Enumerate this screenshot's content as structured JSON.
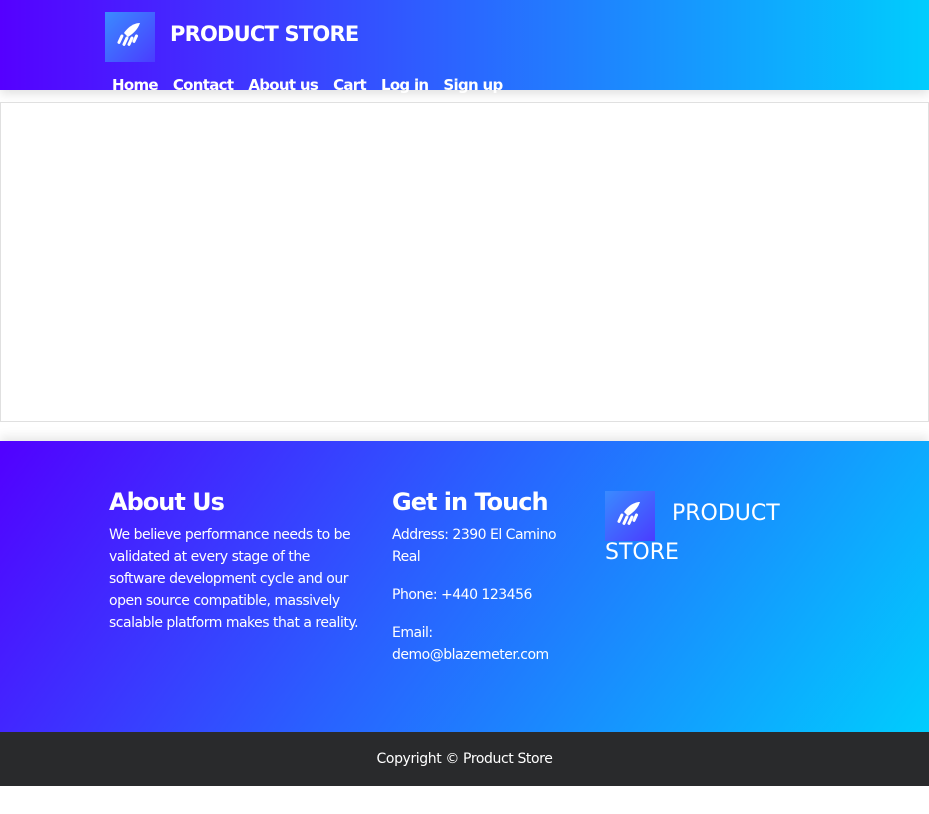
{
  "header": {
    "brand": "PRODUCT STORE",
    "logo_icon": "rocket-icon",
    "nav": [
      {
        "label": "Home"
      },
      {
        "label": "Contact"
      },
      {
        "label": "About us"
      },
      {
        "label": "Cart"
      },
      {
        "label": "Log in"
      },
      {
        "label": "Sign up"
      }
    ]
  },
  "footer": {
    "about": {
      "title": "About Us",
      "body": "We believe performance needs to be validated at every stage of the software development cycle and our open source compatible, massively scalable platform makes that a reality."
    },
    "contact": {
      "title": "Get in Touch",
      "address": "Address: 2390 El Camino Real",
      "phone": "Phone: +440 123456",
      "email_label": "Email:",
      "email": "demo@blazemeter.com"
    },
    "brand_line1": "PRODUCT",
    "brand_line2": "STORE",
    "logo_icon": "rocket-icon"
  },
  "copyright": "Copyright © Product Store",
  "colors": {
    "gradient_start": "#5500ff",
    "gradient_end": "#00cdfd",
    "copyright_bg": "#292a2c"
  }
}
